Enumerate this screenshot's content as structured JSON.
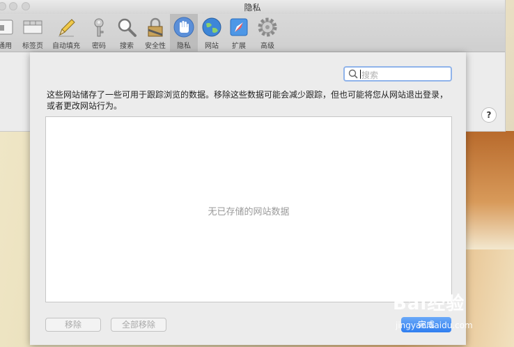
{
  "window": {
    "title": "隐私",
    "toolbar": [
      {
        "label": "通用",
        "icon": "general-icon"
      },
      {
        "label": "标签页",
        "icon": "tabs-icon"
      },
      {
        "label": "自动填充",
        "icon": "autofill-pencil-icon"
      },
      {
        "label": "密码",
        "icon": "key-icon"
      },
      {
        "label": "搜索",
        "icon": "search-magnifier-icon"
      },
      {
        "label": "安全性",
        "icon": "lock-icon"
      },
      {
        "label": "隐私",
        "icon": "hand-icon",
        "active": true
      },
      {
        "label": "网站",
        "icon": "globe-icon"
      },
      {
        "label": "扩展",
        "icon": "puzzle-icon"
      },
      {
        "label": "高级",
        "icon": "gear-icon"
      }
    ],
    "help_label": "?"
  },
  "sheet": {
    "search_placeholder": "搜索",
    "description": "这些网站储存了一些可用于跟踪浏览的数据。移除这些数据可能会减少跟踪，但也可能将您从网站退出登录，或者更改网站行为。",
    "empty_text": "无已存储的网站数据",
    "remove_button": "移除",
    "remove_all_button": "全部移除",
    "done_button": "完成"
  },
  "watermark": {
    "brand": "Bai经验",
    "url": "jingyan.baidu.com"
  }
}
